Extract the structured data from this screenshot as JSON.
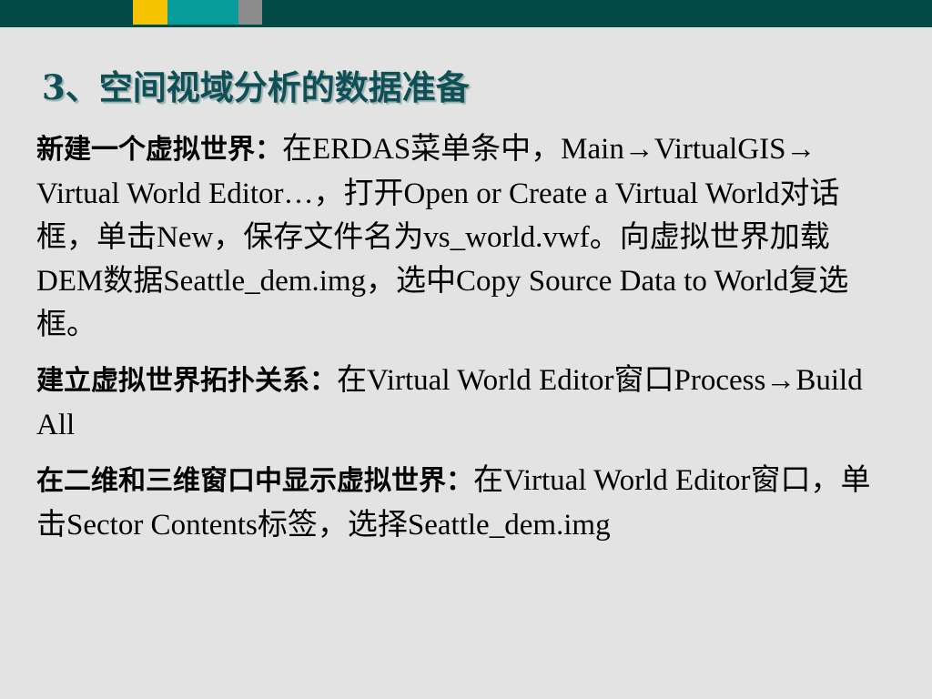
{
  "colors": {
    "bar_dark": "#034a46",
    "bar_yellow": "#f6c300",
    "bar_teal": "#089c9a",
    "bar_gray": "#8c8c8c",
    "title": "#0f4f56",
    "background": "#e3e3e3"
  },
  "title": "3、空间视域分析的数据准备",
  "paragraphs": [
    {
      "lead": "新建一个虚拟世界：",
      "parts": [
        "在ERDAS菜单条中，Main",
        "VirtualGIS",
        " Virtual World Editor…，打开Open or Create a Virtual World对话框，单击New，保存文件名为vs_world.vwf。向虚拟世界加载DEM数据Seattle_dem.img，选中Copy Source Data to World复选框。"
      ],
      "arrow": "→"
    },
    {
      "lead": "建立虚拟世界拓扑关系：",
      "parts": [
        "在Virtual World Editor窗口Process",
        "Build All"
      ],
      "arrow": "→"
    },
    {
      "lead": "在二维和三维窗口中显示虚拟世界：",
      "text": "在Virtual World Editor窗口，单击Sector Contents标签，选择Seattle_dem.img"
    }
  ]
}
